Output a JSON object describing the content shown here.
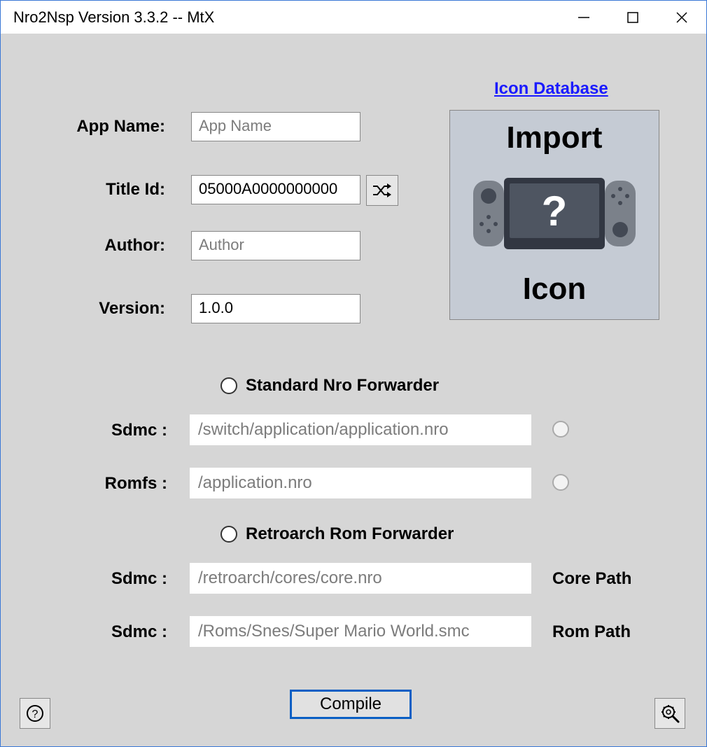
{
  "window": {
    "title": "Nro2Nsp Version 3.3.2 -- MtX"
  },
  "form": {
    "app_name_label": "App Name:",
    "app_name_placeholder": "App Name",
    "title_id_label": "Title Id:",
    "title_id_value": "05000A0000000000",
    "author_label": "Author:",
    "author_placeholder": "Author",
    "version_label": "Version:",
    "version_value": "1.0.0"
  },
  "iconbox": {
    "link": "Icon Database",
    "line1": "Import",
    "line2": "Icon"
  },
  "forwarder": {
    "standard_label": "Standard Nro Forwarder",
    "sdmc_label": "Sdmc :",
    "romfs_label": "Romfs :",
    "sdmc_placeholder": "/switch/application/application.nro",
    "romfs_placeholder": "/application.nro",
    "retro_label": "Retroarch Rom Forwarder",
    "core_placeholder": "/retroarch/cores/core.nro",
    "rom_placeholder": "/Roms/Snes/Super Mario World.smc",
    "core_side": "Core Path",
    "rom_side": "Rom Path"
  },
  "buttons": {
    "compile": "Compile"
  }
}
